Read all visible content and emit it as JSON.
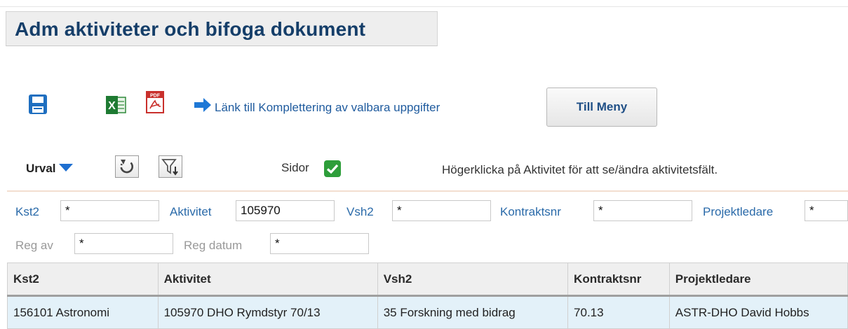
{
  "page": {
    "title": "Adm aktiviteter och bifoga dokument"
  },
  "toolbar": {
    "save_icon": "save-icon",
    "excel_icon": "excel-icon",
    "pdf_icon": "pdf-icon",
    "pdf_icon_text": "PDF",
    "excel_icon_text": "X",
    "link_icon": "arrow-right-icon",
    "link_text": "Länk till Komplettering av valbara uppgifter",
    "menu_button": "Till Meny"
  },
  "selection": {
    "urval_label": "Urval",
    "refresh_icon": "refresh-icon",
    "filter_icon": "filter-icon",
    "sidor_label": "Sidor",
    "sidor_checked": true,
    "hint": "Högerklicka på Aktivitet för att se/ändra aktivitetsfält."
  },
  "filters": {
    "kst2": {
      "label": "Kst2",
      "value": "*"
    },
    "aktivitet": {
      "label": "Aktivitet",
      "value": "105970"
    },
    "vsh2": {
      "label": "Vsh2",
      "value": "*"
    },
    "kontraktsnr": {
      "label": "Kontraktsnr",
      "value": "*"
    },
    "projektledare": {
      "label": "Projektledare",
      "value": "*"
    },
    "reg_av": {
      "label": "Reg av",
      "value": "*"
    },
    "reg_datum": {
      "label": "Reg datum",
      "value": "*"
    }
  },
  "table": {
    "headers": [
      "Kst2",
      "Aktivitet",
      "Vsh2",
      "Kontraktsnr",
      "Projektledare"
    ],
    "rows": [
      [
        "156101 Astronomi",
        "105970 DHO Rymdstyr 70/13",
        "35 Forskning med bidrag",
        "70.13",
        "ASTR-DHO David Hobbs"
      ]
    ]
  },
  "colors": {
    "title": "#153e69",
    "link": "#1f5b9e",
    "filter_label": "#2a6aa9",
    "checkbox": "#2e9e3a",
    "row_highlight": "#e3f1f9",
    "urval_arrow": "#1e6fd0"
  }
}
